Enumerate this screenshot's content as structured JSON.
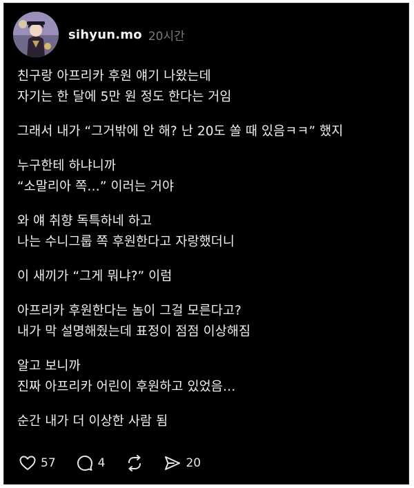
{
  "post": {
    "username": "sihyun.mo",
    "time": "20시간",
    "paragraphs": [
      {
        "lines": [
          "친구랑 아프리카 후원 얘기 나왔는데",
          "자기는 한 달에 5만 원 정도 한다는 거임"
        ]
      },
      {
        "lines": [
          "그래서 내가 “그거밖에 안 해? 난 20도 쏠 때 있음ㅋㅋ” 했지"
        ]
      },
      {
        "lines": [
          "누구한테 하냐니까",
          "“소말리아 쪽…” 이러는 거야"
        ]
      },
      {
        "lines": [
          "와 얘 취향 독특하네 하고",
          "나는 수니그룹 쪽 후원한다고 자랑했더니"
        ]
      },
      {
        "lines": [
          "이 새끼가 “그게 뭐냐?” 이럼"
        ]
      },
      {
        "lines": [
          "아프리카 후원한다는 놈이 그걸 모른다고?",
          "내가 막 설명해줬는데 표정이 점점 이상해짐"
        ]
      },
      {
        "lines": [
          "알고 보니까",
          "진짜 아프리카 어린이 후원하고 있었음…"
        ]
      },
      {
        "lines": [
          "순간 내가 더 이상한 사람 됨"
        ]
      }
    ]
  },
  "actions": {
    "like": {
      "icon": "heart-icon",
      "count": "57"
    },
    "comment": {
      "icon": "comment-icon",
      "count": "4"
    },
    "repost": {
      "icon": "repost-icon"
    },
    "share": {
      "icon": "send-icon",
      "count": "20"
    }
  },
  "colors": {
    "background": "#000000",
    "text": "#efefef",
    "muted": "#7a7a7a"
  }
}
